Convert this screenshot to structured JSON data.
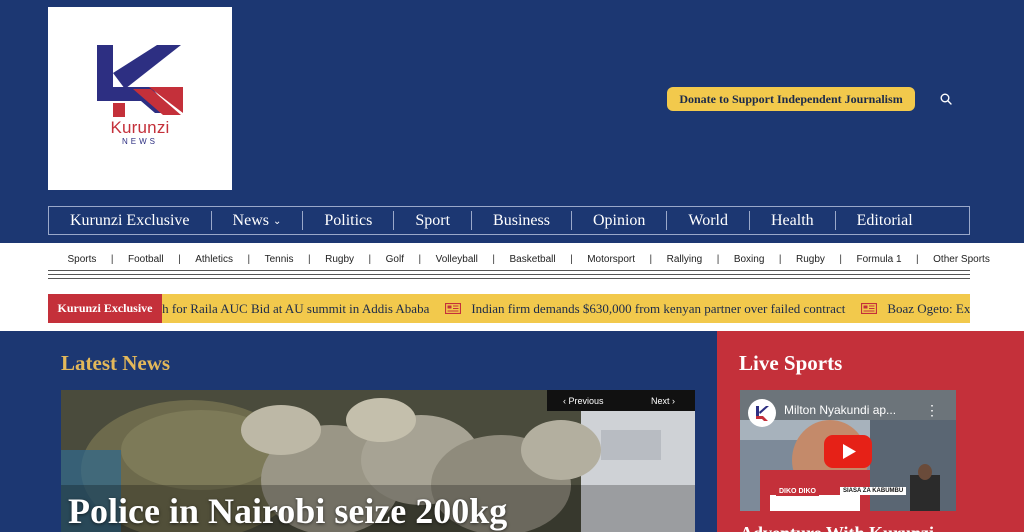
{
  "brand": {
    "logo_word": "Kurunzi",
    "logo_sub": "NEWS",
    "colors": {
      "navy": "#1c3772",
      "red": "#c4303a",
      "gold": "#f2c94c",
      "logo_blue": "#2d2f82"
    }
  },
  "header": {
    "donate_label": "Donate to Support Independent Journalism",
    "search_icon": "search-icon"
  },
  "main_nav": {
    "items": [
      {
        "label": "Kurunzi Exclusive"
      },
      {
        "label": "News",
        "has_dropdown": true
      },
      {
        "label": "Politics"
      },
      {
        "label": "Sport"
      },
      {
        "label": "Business"
      },
      {
        "label": "Opinion"
      },
      {
        "label": "World"
      },
      {
        "label": "Health"
      },
      {
        "label": "Editorial"
      }
    ]
  },
  "sub_nav": {
    "items": [
      "Sports",
      "Football",
      "Athletics",
      "Tennis",
      "Rugby",
      "Golf",
      "Volleyball",
      "Basketball",
      "Motorsport",
      "Rallying",
      "Boxing",
      "Rugby",
      "Formula 1",
      "Other Sports"
    ],
    "separator": "|"
  },
  "ticker": {
    "label": "Kurunzi Exclusive",
    "items": [
      "Last-minute push for Raila AUC Bid at AU summit in Addis Ababa",
      "Indian firm demands $630,000 from kenyan partner over failed contract",
      "Boaz Ogeto: Ex"
    ]
  },
  "latest": {
    "title": "Latest News",
    "pager": {
      "previous": "Previous",
      "next": "Next"
    },
    "headline": "Police in Nairobi seize 200kg"
  },
  "live": {
    "title": "Live Sports",
    "video": {
      "title": "Milton Nyakundi ap...",
      "caption_left": "DIKO DIKO",
      "caption_right": "SIASA ZA KABUMBU"
    },
    "next_heading": "Adventure With Kurunzi..."
  }
}
